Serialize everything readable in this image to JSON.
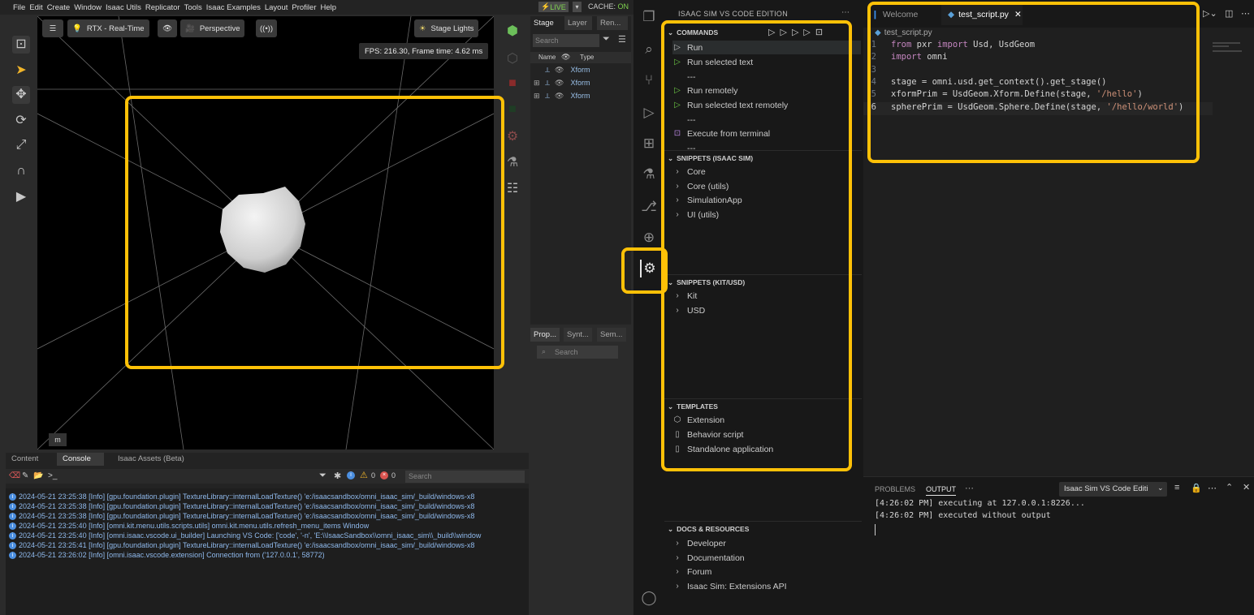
{
  "isaac": {
    "menu": [
      "File",
      "Edit",
      "Create",
      "Window",
      "Isaac Utils",
      "Replicator",
      "Tools",
      "Isaac Examples",
      "Layout",
      "Profiler",
      "Help"
    ],
    "live_label": "LIVE",
    "cache_label": "CACHE:",
    "cache_status": "ON",
    "viewport": {
      "render_mode": "RTX - Real-Time",
      "camera": "Perspective",
      "lights": "Stage Lights",
      "fps_text": "FPS: 216.30, Frame time: 4.62 ms",
      "m_label": "m"
    },
    "stage": {
      "tabs": [
        "Stage",
        "Layer",
        "Ren..."
      ],
      "search_placeholder": "Search",
      "col_name": "Name",
      "col_type": "Type",
      "rows": [
        "Xform",
        "Xform",
        "Xform"
      ]
    },
    "property": {
      "tabs": [
        "Prop...",
        "Synt...",
        "Sem..."
      ],
      "search_placeholder": "Search"
    },
    "bottom": {
      "tabs": [
        "Content",
        "Console",
        "Isaac Assets (Beta)"
      ],
      "warn_count": "0",
      "err_count": "0",
      "search_placeholder": "Search",
      "logs": [
        "2024-05-21 23:25:38  [Info] [gpu.foundation.plugin] TextureLibrary::internalLoadTexture() 'e:/isaacsandbox/omni_isaac_sim/_build/windows-x8",
        "2024-05-21 23:25:38  [Info] [gpu.foundation.plugin] TextureLibrary::internalLoadTexture() 'e:/isaacsandbox/omni_isaac_sim/_build/windows-x8",
        "2024-05-21 23:25:38  [Info] [gpu.foundation.plugin] TextureLibrary::internalLoadTexture() 'e:/isaacsandbox/omni_isaac_sim/_build/windows-x8",
        "2024-05-21 23:25:40  [Info] [omni.kit.menu.utils.scripts.utils] omni.kit.menu.utils.refresh_menu_items Window",
        "2024-05-21 23:25:40  [Info] [omni.isaac.vscode.ui_builder] Launching VS Code: ['code', '-n', 'E:\\\\IsaacSandbox\\\\omni_isaac_sim\\\\_build\\\\window",
        "2024-05-21 23:25:41  [Info] [gpu.foundation.plugin] TextureLibrary::internalLoadTexture() 'e:/isaacsandbox/omni_isaac_sim/_build/windows-x8",
        "2024-05-21 23:26:02  [Info] [omni.isaac.vscode.extension] Connection from ('127.0.0.1', 58772)"
      ]
    }
  },
  "vscode": {
    "sidebar_title": "ISAAC SIM VS CODE EDITION",
    "commands": {
      "title": "COMMANDS",
      "items": [
        "Run",
        "Run selected text",
        "---",
        "Run remotely",
        "Run selected text remotely",
        "---",
        "Execute from terminal",
        "---"
      ]
    },
    "snippets_isaac": {
      "title": "SNIPPETS (ISAAC SIM)",
      "items": [
        "Core",
        "Core (utils)",
        "SimulationApp",
        "UI (utils)"
      ]
    },
    "snippets_kit": {
      "title": "SNIPPETS (KIT/USD)",
      "items": [
        "Kit",
        "USD"
      ]
    },
    "templates": {
      "title": "TEMPLATES",
      "items": [
        "Extension",
        "Behavior script",
        "Standalone application"
      ]
    },
    "docs": {
      "title": "DOCS & RESOURCES",
      "items": [
        "Developer",
        "Documentation",
        "Forum",
        "Isaac Sim: Extensions API"
      ]
    },
    "editor": {
      "tab_welcome": "Welcome",
      "tab_file": "test_script.py",
      "breadcrumb": "test_script.py",
      "lines": [
        {
          "n": "1",
          "kw1": "from",
          "t1": " pxr ",
          "kw2": "import",
          "t2": " Usd, UsdGeom",
          "s": "",
          "e": ""
        },
        {
          "n": "2",
          "kw1": "import",
          "t1": " omni",
          "kw2": "",
          "t2": "",
          "s": "",
          "e": ""
        },
        {
          "n": "3",
          "kw1": "",
          "t1": "",
          "kw2": "",
          "t2": "",
          "s": "",
          "e": ""
        },
        {
          "n": "4",
          "kw1": "",
          "t1": "stage = omni.usd.get_context().get_stage()",
          "kw2": "",
          "t2": "",
          "s": "",
          "e": ""
        },
        {
          "n": "5",
          "kw1": "",
          "t1": "xformPrim = UsdGeom.Xform.Define(stage, ",
          "kw2": "",
          "t2": "",
          "s": "'/hello'",
          "e": ")"
        },
        {
          "n": "6",
          "kw1": "",
          "t1": "spherePrim = UsdGeom.Sphere.Define(stage, ",
          "kw2": "",
          "t2": "",
          "s": "'/hello/world'",
          "e": ")"
        }
      ]
    },
    "panel": {
      "tab_problems": "PROBLEMS",
      "tab_output": "OUTPUT",
      "output_channel": "Isaac Sim VS Code Editi",
      "output_lines": [
        "[4:26:02 PM] executing at 127.0.0.1:8226...",
        "[4:26:02 PM] executed without output"
      ]
    }
  },
  "colors": {
    "highlight": "#ffc107",
    "live_green": "#7fd34e",
    "run_green": "#6cc644"
  }
}
